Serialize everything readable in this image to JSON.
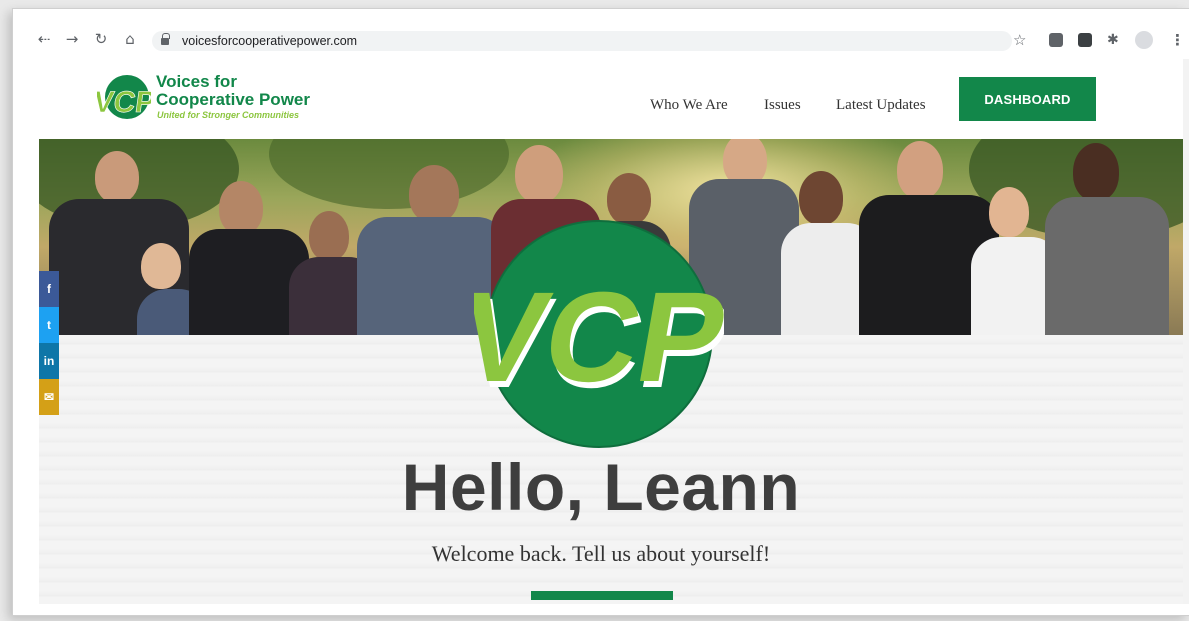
{
  "browser": {
    "url": "voicesforcooperativepower.com",
    "back_icon": "back-arrow-icon",
    "forward_icon": "forward-arrow-icon",
    "reload_icon": "reload-icon",
    "home_icon": "home-icon"
  },
  "site": {
    "logo_mark": "VCP",
    "name_line1": "Voices for",
    "name_line2": "Cooperative Power",
    "tagline": "United for Stronger Communities"
  },
  "nav": {
    "items": [
      {
        "label": "Who We Are"
      },
      {
        "label": "Issues"
      },
      {
        "label": "Latest Updates"
      }
    ],
    "dashboard_label": "DASHBOARD"
  },
  "social": [
    {
      "label": "f",
      "color": "#3b5998",
      "icon": "facebook-icon"
    },
    {
      "label": "t",
      "color": "#1da1f2",
      "icon": "twitter-icon"
    },
    {
      "label": "in",
      "color": "#0e76a8",
      "icon": "linkedin-icon"
    },
    {
      "label": "✉",
      "color": "#d4a017",
      "icon": "email-icon"
    }
  ],
  "hero": {
    "badge_text": "VCP"
  },
  "greeting": {
    "title": "Hello, Leann",
    "subtitle": "Welcome back. Tell us about yourself!"
  },
  "colors": {
    "brand_green": "#12874a",
    "accent_green": "#8cc63f"
  }
}
